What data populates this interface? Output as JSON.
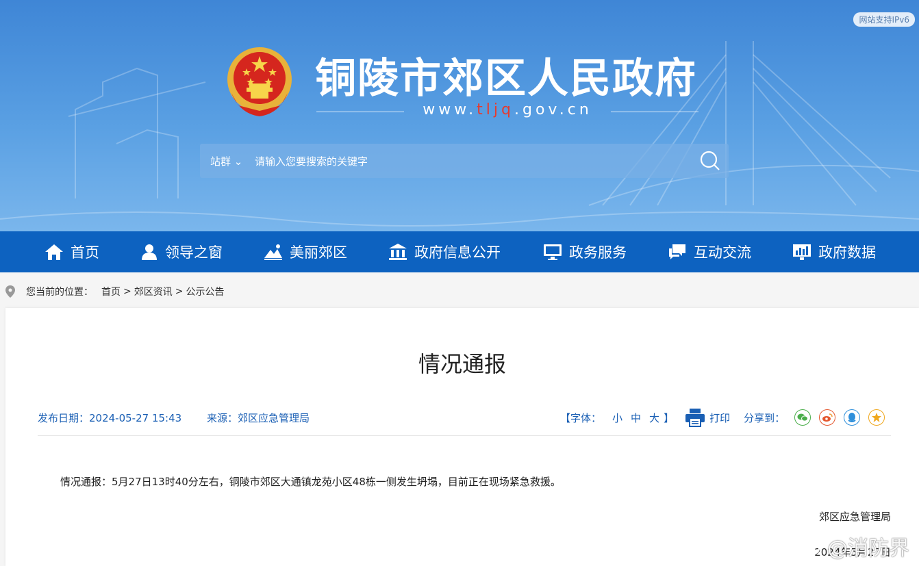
{
  "header": {
    "ipv6_badge": "网站支持IPv6",
    "site_title": "铜陵市郊区人民政府",
    "url_prefix": "www.",
    "url_highlight": "tljq",
    "url_suffix": ".gov.cn"
  },
  "search": {
    "group_label": "站群",
    "placeholder": "请输入您要搜索的关键字"
  },
  "nav": {
    "items": [
      {
        "label": "首页",
        "icon": "home-icon"
      },
      {
        "label": "领导之窗",
        "icon": "person-icon"
      },
      {
        "label": "美丽郊区",
        "icon": "landscape-icon"
      },
      {
        "label": "政府信息公开",
        "icon": "building-icon"
      },
      {
        "label": "政务服务",
        "icon": "monitor-icon"
      },
      {
        "label": "互动交流",
        "icon": "chat-icon"
      },
      {
        "label": "政府数据",
        "icon": "chart-icon"
      }
    ]
  },
  "breadcrumb": {
    "prefix": "您当前的位置：",
    "items": [
      "首页",
      "郊区资讯",
      "公示公告"
    ],
    "separator": ">"
  },
  "article": {
    "title": "情况通报",
    "publish_date": "发布日期：2024-05-27 15:43",
    "source": "来源：郊区应急管理局",
    "font_label": "【字体：",
    "font_small": "小",
    "font_medium": "中",
    "font_large": "大",
    "font_close": "】",
    "print_label": "打印",
    "share_label": "分享到：",
    "body": "情况通报：5月27日13时40分左右，铜陵市郊区大通镇龙苑小区48栋一侧发生坍塌，目前正在现场紧急救援。",
    "signature_org": "郊区应急管理局",
    "signature_date": "2024年5月27日"
  },
  "watermark": "@消防界",
  "colors": {
    "nav_bg": "#0d62c0",
    "link_blue": "#1a5fb4",
    "url_red": "#e63b2e"
  }
}
